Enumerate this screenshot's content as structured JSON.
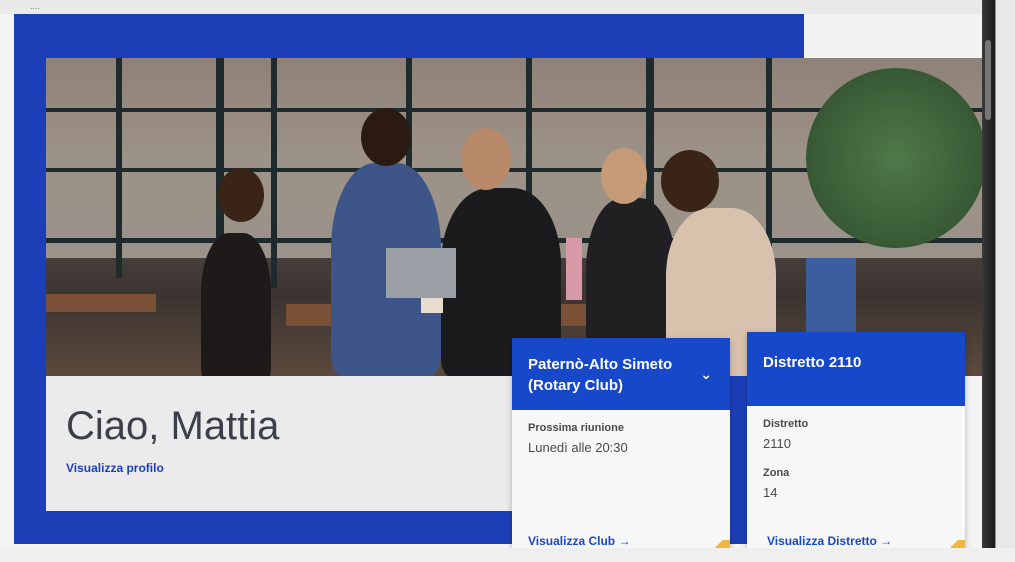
{
  "greeting": {
    "title": "Ciao, Mattia",
    "profile_link": "Visualizza profilo"
  },
  "club_card": {
    "name": "Paternò-Alto Simeto (Rotary Club)",
    "next_meeting_label": "Prossima riunione",
    "next_meeting_value": "Lunedì alle 20:30",
    "link": "Visualizza Club →"
  },
  "district_card": {
    "title": "Distretto 2110",
    "district_label": "Distretto",
    "district_value": "2110",
    "zone_label": "Zona",
    "zone_value": "14",
    "link": "Visualizza Distretto →"
  },
  "icons": {
    "club_dropdown": "chevron-down-icon"
  },
  "colors": {
    "brand_blue": "#1c3fb8",
    "accent_gold": "#f0b640"
  }
}
